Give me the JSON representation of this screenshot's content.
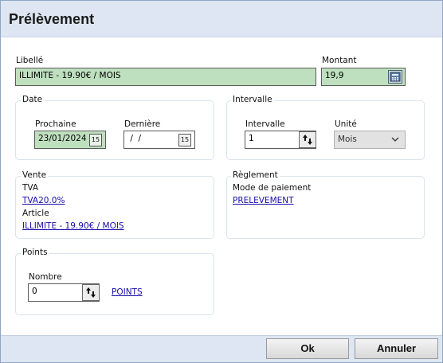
{
  "window": {
    "title": "Prélèvement"
  },
  "libelle": {
    "label": "Libellé",
    "value": "ILLIMITE - 19.90€ / MOIS"
  },
  "montant": {
    "label": "Montant",
    "value": "19,9",
    "calc_icon": "calculator-icon"
  },
  "date_group": {
    "title": "Date",
    "prochaine": {
      "label": "Prochaine",
      "value": "23/01/2024",
      "icon": "calendar-icon",
      "icon_text": "15"
    },
    "derniere": {
      "label": "Dernière",
      "value": " /  /",
      "icon": "calendar-icon",
      "icon_text": "15"
    }
  },
  "intervalle_group": {
    "title": "Intervalle",
    "intervalle": {
      "label": "Intervalle",
      "value": "1",
      "icon": "spinner-arrows-icon"
    },
    "unite": {
      "label": "Unité",
      "value": "Mois",
      "icon": "chevron-down-icon"
    }
  },
  "vente_group": {
    "title": "Vente",
    "tva_label": "TVA",
    "tva_link": "TVA20.0%",
    "article_label": "Article",
    "article_link": "ILLIMITE - 19.90€ / MOIS"
  },
  "reglement_group": {
    "title": "Règlement",
    "mode_label": "Mode de paiement",
    "mode_link": "PRELEVEMENT"
  },
  "points_group": {
    "title": "Points",
    "nombre_label": "Nombre",
    "nombre_value": "0",
    "points_link": "POINTS",
    "icon": "spinner-arrows-icon"
  },
  "footer": {
    "ok_label": "Ok",
    "cancel_label": "Annuler"
  },
  "colors": {
    "green_field": "#bfe0bf",
    "header_bg": "#dde6f2",
    "link": "#1a0dab"
  }
}
